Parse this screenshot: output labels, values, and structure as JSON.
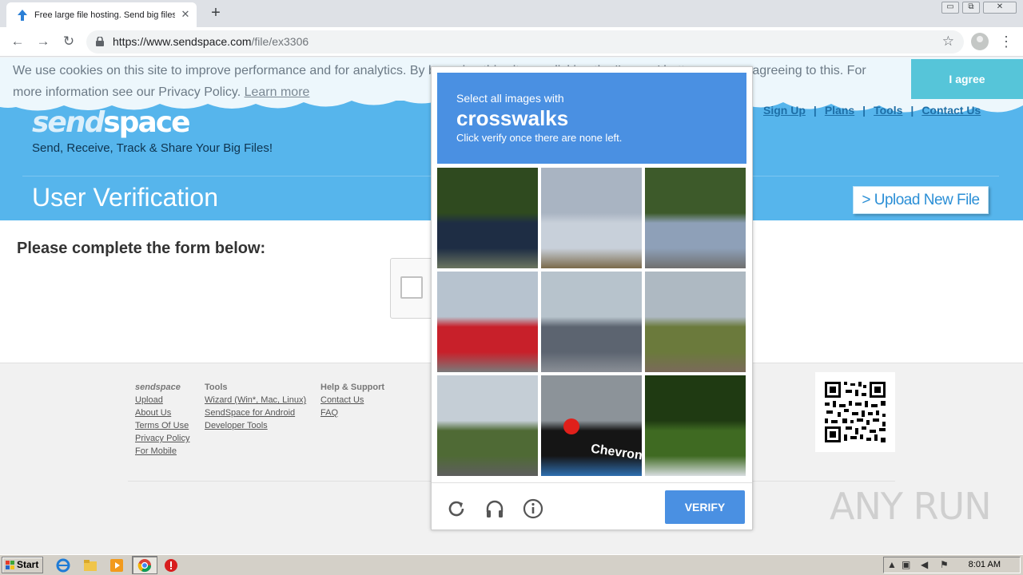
{
  "browser": {
    "tab_title": "Free large file hosting. Send big files",
    "tab_close": "✕",
    "new_tab": "+",
    "url_host": "https://www.sendspace.com",
    "url_path": "/file/ex3306",
    "window_controls": [
      "▭",
      "⧉",
      "✕"
    ]
  },
  "cookie_banner": {
    "text": "We use cookies on this site to improve performance and for analytics. By browsing this site, or clicking the 'I agree' button, you are agreeing to this. For more information see our Privacy Policy.",
    "learn_more": "Learn more",
    "agree_button": "I agree"
  },
  "header": {
    "logo_send": "send",
    "logo_space": "space",
    "tagline": "Send, Receive, Track & Share Your Big Files!",
    "nav": [
      "Sign Up",
      "Plans",
      "Tools",
      "Contact Us"
    ],
    "nav_separator": "|",
    "section_title": "User Verification",
    "upload_button": "> Upload New File"
  },
  "main": {
    "form_heading": "Please complete the form below:"
  },
  "footer": {
    "col1_head": "sendspace",
    "col1_links": [
      "Upload",
      "About Us",
      "Terms Of Use",
      "Privacy Policy",
      "For Mobile"
    ],
    "col2_head": "Tools",
    "col2_links": [
      "Wizard (Win*, Mac, Linux)",
      "SendSpace for Android",
      "Developer Tools"
    ],
    "col3_head": "Help & Support",
    "col3_links": [
      "Contact Us",
      "FAQ"
    ],
    "watermark": "ANY RUN"
  },
  "captcha": {
    "line1": "Select all images with",
    "target": "crosswalks",
    "line3": "Click verify once there are none left.",
    "tiles": [
      {
        "name": "tile-pickup-truck",
        "palette": [
          "#2f4a1f",
          "#1e2d44",
          "#6b7560"
        ]
      },
      {
        "name": "tile-power-lines",
        "palette": [
          "#a9b4c2",
          "#c8d0da",
          "#7a6a4a"
        ]
      },
      {
        "name": "tile-bus-street",
        "palette": [
          "#3d5a2a",
          "#8ea0b8",
          "#6f6f6f"
        ]
      },
      {
        "name": "tile-red-truck",
        "palette": [
          "#b7c3cf",
          "#c8202a",
          "#7a7a7a"
        ]
      },
      {
        "name": "tile-roof",
        "palette": [
          "#b7c3cc",
          "#5c6470",
          "#8a8f96"
        ]
      },
      {
        "name": "tile-field-road",
        "palette": [
          "#aeb9c2",
          "#6b7a3c",
          "#7a6a5a"
        ]
      },
      {
        "name": "tile-rural-road",
        "palette": [
          "#c5ced6",
          "#4f6a35",
          "#5e5e5e"
        ]
      },
      {
        "name": "tile-traffic-light",
        "palette": [
          "#8c9399",
          "#151515",
          "#2e6fb0"
        ]
      },
      {
        "name": "tile-foliage-car",
        "palette": [
          "#1f3a12",
          "#3f6a22",
          "#d8dde0"
        ]
      }
    ],
    "tile_labels": {
      "tile-traffic-light": "Chevron"
    },
    "verify_button": "VERIFY"
  },
  "taskbar": {
    "start": "Start",
    "clock": "8:01 AM"
  }
}
